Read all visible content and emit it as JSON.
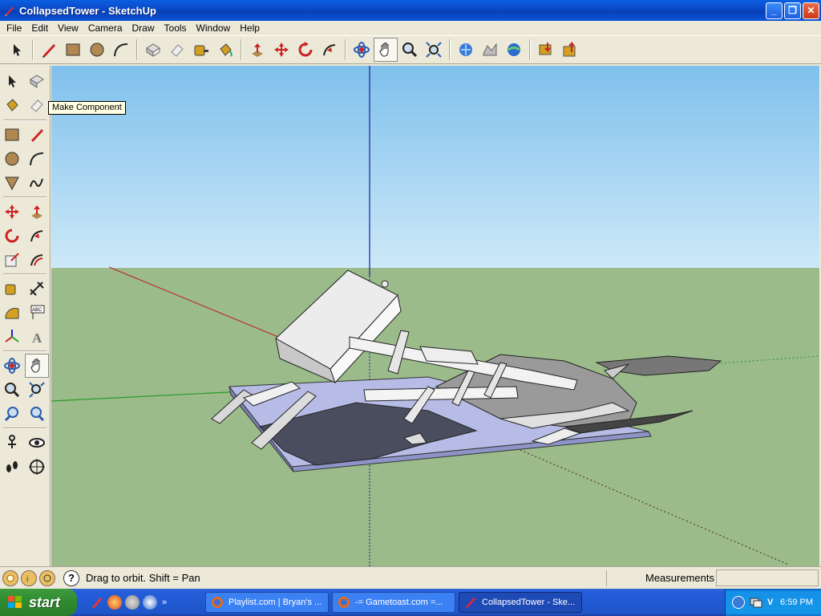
{
  "window": {
    "title": "CollapsedTower - SketchUp"
  },
  "menu": [
    "File",
    "Edit",
    "View",
    "Camera",
    "Draw",
    "Tools",
    "Window",
    "Help"
  ],
  "top_toolbar": {
    "tools": [
      "select-tool",
      "pencil-tool",
      "rectangle-tool",
      "circle-tool",
      "arc-tool",
      "make-component-tool",
      "eraser-tool",
      "tape-measure-tool",
      "paint-bucket-tool",
      "push-pull-tool",
      "move-tool",
      "rotate-tool",
      "follow-me-tool",
      "orbit-tool",
      "pan-tool",
      "zoom-tool",
      "zoom-extents-tool",
      "get-current-view-tool",
      "toggle-terrain-tool",
      "place-model-tool",
      "get-models-tool",
      "share-model-tool"
    ],
    "active": "pan-tool"
  },
  "left_toolbar": {
    "active": "pan-tool"
  },
  "tooltip": {
    "text": "Make Component"
  },
  "status": {
    "message": "Drag to orbit.  Shift = Pan",
    "measurements_label": "Measurements",
    "measurements_value": ""
  },
  "taskbar": {
    "start_label": "start",
    "tasks": [
      {
        "label": "Playlist.com | Bryan's ...",
        "icon": "firefox-icon"
      },
      {
        "label": "-= Gametoast.com =...",
        "icon": "firefox-icon"
      },
      {
        "label": "CollapsedTower - Ske...",
        "icon": "sketchup-icon",
        "active": true
      }
    ],
    "clock": "6:59 PM"
  },
  "colors": {
    "sky": "#8fc7ec",
    "ground": "#9bbb8a",
    "titlebar": "#0a48c8",
    "platform": "#b7bce6"
  }
}
